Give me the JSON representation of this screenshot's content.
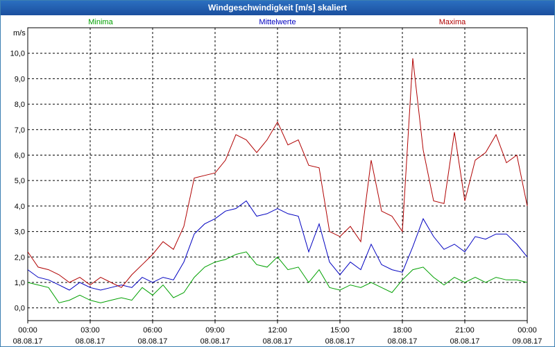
{
  "window": {
    "title": "Windgeschwindigkeit [m/s] skaliert"
  },
  "chart_data": {
    "type": "line",
    "title": "Windgeschwindigkeit [m/s] skaliert",
    "ylabel": "m/s",
    "ylim": [
      -0.5,
      11.0
    ],
    "xlim": [
      0,
      24
    ],
    "grid": true,
    "legend_placement": "top",
    "y_ticks": [
      "0,0",
      "1,0",
      "2,0",
      "3,0",
      "4,0",
      "5,0",
      "6,0",
      "7,0",
      "8,0",
      "9,0",
      "10,0"
    ],
    "y_tick_values": [
      0,
      1,
      2,
      3,
      4,
      5,
      6,
      7,
      8,
      9,
      10
    ],
    "x_ticks": [
      {
        "time": "00:00",
        "date": "08.08.17"
      },
      {
        "time": "03:00",
        "date": "08.08.17"
      },
      {
        "time": "06:00",
        "date": "08.08.17"
      },
      {
        "time": "09:00",
        "date": "08.08.17"
      },
      {
        "time": "12:00",
        "date": "08.08.17"
      },
      {
        "time": "15:00",
        "date": "08.08.17"
      },
      {
        "time": "18:00",
        "date": "08.08.17"
      },
      {
        "time": "21:00",
        "date": "08.08.17"
      },
      {
        "time": "00:00",
        "date": "09.08.17"
      }
    ],
    "x": [
      0,
      0.5,
      1,
      1.5,
      2,
      2.5,
      3,
      3.5,
      4,
      4.5,
      5,
      5.5,
      6,
      6.5,
      7,
      7.5,
      8,
      8.5,
      9,
      9.5,
      10,
      10.5,
      11,
      11.5,
      12,
      12.5,
      13,
      13.5,
      14,
      14.5,
      15,
      15.5,
      16,
      16.5,
      17,
      17.5,
      18,
      18.5,
      19,
      19.5,
      20,
      20.5,
      21,
      21.5,
      22,
      22.5,
      23,
      23.5,
      24
    ],
    "series": [
      {
        "name": "Minima",
        "color": "#00a000",
        "values": [
          1.0,
          0.9,
          0.8,
          0.2,
          0.3,
          0.5,
          0.3,
          0.2,
          0.3,
          0.4,
          0.3,
          0.8,
          0.5,
          0.9,
          0.4,
          0.6,
          1.2,
          1.6,
          1.8,
          1.9,
          2.1,
          2.2,
          1.7,
          1.6,
          2.0,
          1.5,
          1.6,
          1.0,
          1.5,
          0.8,
          0.7,
          0.9,
          0.8,
          1.0,
          0.8,
          0.6,
          1.1,
          1.5,
          1.6,
          1.2,
          0.9,
          1.2,
          1.0,
          1.2,
          1.0,
          1.2,
          1.1,
          1.1,
          1.0
        ]
      },
      {
        "name": "Mittelwerte",
        "color": "#0000c0",
        "values": [
          1.5,
          1.2,
          1.1,
          0.9,
          0.7,
          1.0,
          0.8,
          0.7,
          0.8,
          0.9,
          0.8,
          1.2,
          1.0,
          1.2,
          1.1,
          1.8,
          2.9,
          3.3,
          3.5,
          3.8,
          3.9,
          4.2,
          3.6,
          3.7,
          3.9,
          3.7,
          3.6,
          2.2,
          3.3,
          1.8,
          1.3,
          1.8,
          1.5,
          2.5,
          1.7,
          1.5,
          1.4,
          2.4,
          3.5,
          2.8,
          2.3,
          2.5,
          2.2,
          2.8,
          2.7,
          2.9,
          2.9,
          2.5,
          2.0
        ]
      },
      {
        "name": "Maxima",
        "color": "#b00000",
        "values": [
          2.2,
          1.6,
          1.5,
          1.3,
          1.0,
          1.2,
          0.9,
          1.2,
          1.0,
          0.8,
          1.3,
          1.7,
          2.1,
          2.6,
          2.3,
          3.2,
          5.1,
          5.2,
          5.3,
          5.8,
          6.8,
          6.6,
          6.1,
          6.6,
          7.3,
          6.4,
          6.6,
          5.6,
          5.5,
          3.0,
          2.8,
          3.2,
          2.6,
          5.8,
          3.8,
          3.6,
          3.0,
          9.8,
          6.2,
          4.2,
          4.1,
          6.9,
          4.2,
          5.8,
          6.1,
          6.8,
          5.7,
          6.0,
          4.0
        ]
      }
    ]
  }
}
